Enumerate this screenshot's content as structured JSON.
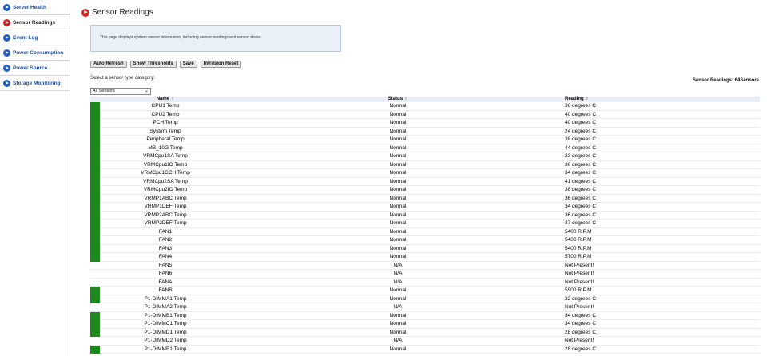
{
  "sidebar": {
    "items": [
      {
        "label": "Server Health",
        "active": false
      },
      {
        "label": "Sensor Readings",
        "active": true
      },
      {
        "label": "Event Log",
        "active": false
      },
      {
        "label": "Power Consumption",
        "active": false
      },
      {
        "label": "Power Source",
        "active": false
      },
      {
        "label": "Storage Monitoring",
        "active": false
      }
    ]
  },
  "page": {
    "title": "Sensor Readings",
    "info": "This page displays system sensor information, including sensor readings and sensor states."
  },
  "toolbar": {
    "auto_refresh": "Auto Refresh",
    "show_thresholds": "Show Thresholds",
    "save": "Save",
    "intrusion_reset": "Intrusion Reset"
  },
  "filter": {
    "label": "Select a sensor type category:",
    "selected": "All Sensors"
  },
  "count_text": "Sensor Readings: 64Sensors",
  "table": {
    "headers": {
      "name": "Name",
      "status": "Status",
      "reading": "Reading"
    },
    "rows": [
      {
        "name": "CPU1 Temp",
        "status": "Normal",
        "reading": "36 degrees C",
        "ok": true
      },
      {
        "name": "CPU2 Temp",
        "status": "Normal",
        "reading": "40 degrees C",
        "ok": true
      },
      {
        "name": "PCH Temp",
        "status": "Normal",
        "reading": "40 degrees C",
        "ok": true
      },
      {
        "name": "System Temp",
        "status": "Normal",
        "reading": "24 degrees C",
        "ok": true
      },
      {
        "name": "Peripheral Temp",
        "status": "Normal",
        "reading": "38 degrees C",
        "ok": true
      },
      {
        "name": "MB_10G Temp",
        "status": "Normal",
        "reading": "44 degrees C",
        "ok": true
      },
      {
        "name": "VRMCpu1SA Temp",
        "status": "Normal",
        "reading": "33 degrees C",
        "ok": true
      },
      {
        "name": "VRMCpu1IO Temp",
        "status": "Normal",
        "reading": "36 degrees C",
        "ok": true
      },
      {
        "name": "VRMCpu1CCH Temp",
        "status": "Normal",
        "reading": "34 degrees C",
        "ok": true
      },
      {
        "name": "VRMCpu2SA Temp",
        "status": "Normal",
        "reading": "41 degrees C",
        "ok": true
      },
      {
        "name": "VRMCpu2IO Temp",
        "status": "Normal",
        "reading": "38 degrees C",
        "ok": true
      },
      {
        "name": "VRMP1ABC Temp",
        "status": "Normal",
        "reading": "36 degrees C",
        "ok": true
      },
      {
        "name": "VRMP1DEF Temp",
        "status": "Normal",
        "reading": "34 degrees C",
        "ok": true
      },
      {
        "name": "VRMP2ABC Temp",
        "status": "Normal",
        "reading": "36 degrees C",
        "ok": true
      },
      {
        "name": "VRMP2DEF Temp",
        "status": "Normal",
        "reading": "37 degrees C",
        "ok": true
      },
      {
        "name": "FAN1",
        "status": "Normal",
        "reading": "5400 R.P.M",
        "ok": true
      },
      {
        "name": "FAN2",
        "status": "Normal",
        "reading": "5400 R.P.M",
        "ok": true
      },
      {
        "name": "FAN3",
        "status": "Normal",
        "reading": "5400 R.P.M",
        "ok": true
      },
      {
        "name": "FAN4",
        "status": "Normal",
        "reading": "5700 R.P.M",
        "ok": true
      },
      {
        "name": "FAN5",
        "status": "N/A",
        "reading": "Not Present!",
        "ok": false
      },
      {
        "name": "FAN6",
        "status": "N/A",
        "reading": "Not Present!",
        "ok": false
      },
      {
        "name": "FANA",
        "status": "N/A",
        "reading": "Not Present!",
        "ok": false
      },
      {
        "name": "FANB",
        "status": "Normal",
        "reading": "5900 R.P.M",
        "ok": true
      },
      {
        "name": "P1-DIMMA1 Temp",
        "status": "Normal",
        "reading": "32 degrees C",
        "ok": true
      },
      {
        "name": "P1-DIMMA2 Temp",
        "status": "N/A",
        "reading": "Not Present!",
        "ok": false
      },
      {
        "name": "P1-DIMMB1 Temp",
        "status": "Normal",
        "reading": "34 degrees C",
        "ok": true
      },
      {
        "name": "P1-DIMMC1 Temp",
        "status": "Normal",
        "reading": "34 degrees C",
        "ok": true
      },
      {
        "name": "P1-DIMMD1 Temp",
        "status": "Normal",
        "reading": "28 degrees C",
        "ok": true
      },
      {
        "name": "P1-DIMMD2 Temp",
        "status": "N/A",
        "reading": "Not Present!",
        "ok": false
      },
      {
        "name": "P1-DIMME1 Temp",
        "status": "Normal",
        "reading": "28 degrees C",
        "ok": true
      }
    ]
  },
  "colors": {
    "ok": "#1e8a1e",
    "link": "#1f4e9e",
    "active_icon": "#d42222",
    "icon": "#1f5fbf"
  }
}
